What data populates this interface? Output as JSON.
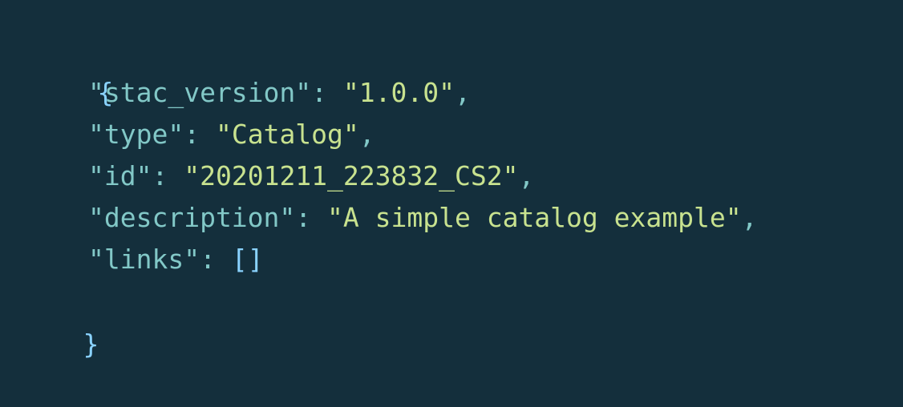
{
  "code": {
    "open_brace": "{",
    "close_brace": "}",
    "entries": [
      {
        "key": "\"stac_version\"",
        "value": "\"1.0.0\"",
        "comma": ","
      },
      {
        "key": "\"type\"",
        "value": "\"Catalog\"",
        "comma": ","
      },
      {
        "key": "\"id\"",
        "value": "\"20201211_223832_CS2\"",
        "comma": ","
      },
      {
        "key": "\"description\"",
        "value": "\"A simple catalog example\"",
        "comma": ","
      },
      {
        "key": "\"links\"",
        "value": "[]",
        "comma": ""
      }
    ],
    "separator": ": "
  },
  "colors": {
    "background": "#142f3c",
    "brace": "#8ad3ff",
    "key": "#82c8c7",
    "string": "#c8e28f",
    "array": "#8ad3ff"
  }
}
